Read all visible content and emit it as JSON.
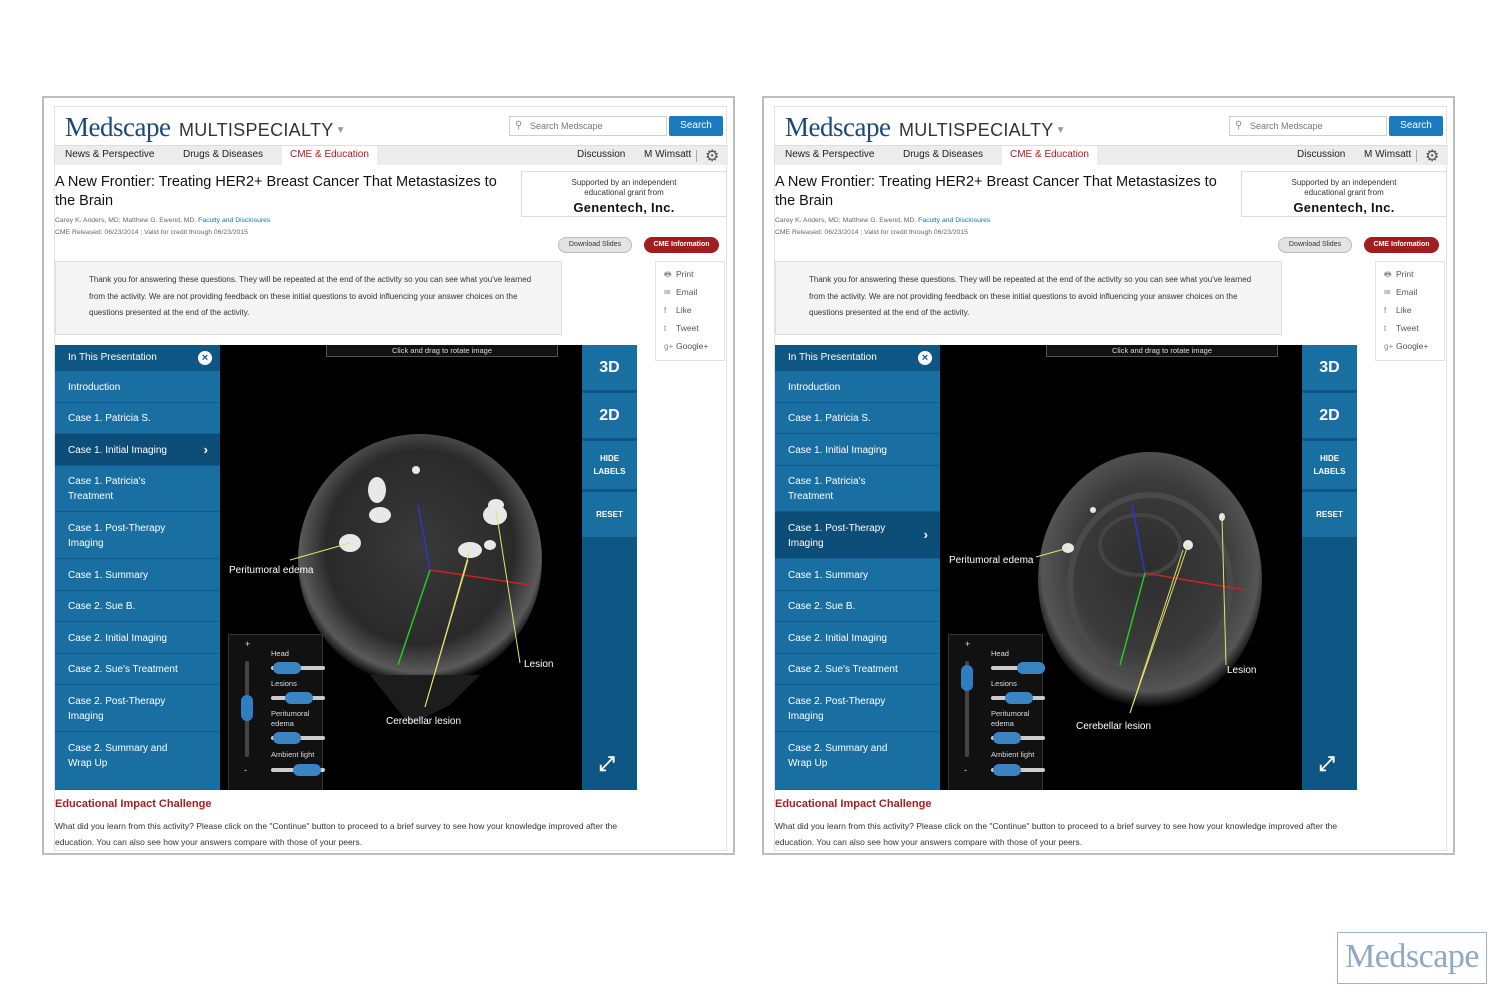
{
  "header": {
    "logo_text": "Medscape",
    "site_section": "MULTISPECIALTY",
    "search_placeholder": "Search Medscape",
    "search_button": "Search"
  },
  "nav": {
    "items": [
      "News & Perspective",
      "Drugs & Diseases",
      "CME & Education"
    ],
    "active_index": 2,
    "discussion": "Discussion",
    "user": "M Wimsatt",
    "settings_icon": "gear-icon"
  },
  "article": {
    "title": "A New Frontier: Treating HER2+ Breast Cancer That Metastasizes to the Brain",
    "authors": "Carey K. Anders, MD; Matthew G. Ewend, MD.",
    "disclosures_link": "Faculty and Disclosures",
    "released": "CME Released: 06/23/2014 ; Valid for credit through 06/23/2015",
    "grant_line": "Supported by an independent educational grant from",
    "grant_company": "Genentech, Inc.",
    "download_slides": "Download Slides",
    "cme_information": "CME Information",
    "thanks_text": "Thank you for answering these questions. They will be repeated at the end of the activity so you can see what you've learned from the activity. We are not providing feedback on these initial questions to avoid influencing your answer choices on the questions presented at the end of the activity."
  },
  "share": {
    "items": [
      {
        "label": "Print",
        "icon": "print-icon"
      },
      {
        "label": "Email",
        "icon": "email-icon"
      },
      {
        "label": "Like",
        "icon": "facebook-icon"
      },
      {
        "label": "Tweet",
        "icon": "twitter-icon"
      },
      {
        "label": "Google+",
        "icon": "googleplus-icon"
      }
    ]
  },
  "presentation": {
    "heading": "In This Presentation",
    "items": [
      "Introduction",
      "Case 1. Patricia S.",
      "Case 1. Initial Imaging",
      "Case 1. Patricia's Treatment",
      "Case 1. Post-Therapy Imaging",
      "Case 1. Summary",
      "Case 2. Sue B.",
      "Case 2. Initial Imaging",
      "Case 2. Sue's Treatment",
      "Case 2. Post-Therapy Imaging",
      "Case 2. Summary and Wrap Up"
    ]
  },
  "viewer": {
    "hint": "Click and drag to rotate image",
    "buttons": {
      "three_d": "3D",
      "two_d": "2D",
      "hide_labels_1": "HIDE",
      "hide_labels_2": "LABELS",
      "reset": "RESET"
    },
    "sliders": {
      "plus": "+",
      "minus": "-",
      "head": "Head",
      "lesions": "Lesions",
      "edema_1": "Peritumoral",
      "edema_2": "edema",
      "ambient": "Ambient light"
    },
    "labels": {
      "edema": "Peritumoral edema",
      "lesion": "Lesion",
      "cerebellar": "Cerebellar lesion"
    }
  },
  "screens": [
    {
      "active_item_index": 2
    },
    {
      "active_item_index": 4
    }
  ],
  "challenge": {
    "title": "Educational Impact Challenge",
    "text": "What did you learn from this activity? Please click on the \"Continue\" button to proceed to a brief survey to see how your knowledge improved after the education. You can also see how your answers compare with those of your peers."
  },
  "watermark": "Medscape",
  "colors": {
    "brand_blue": "#1b4a79",
    "menu_blue": "#1a6fa2",
    "active_menu": "#0d4e78",
    "cme_red": "#a21e1e",
    "search_blue": "#1a7bbf"
  }
}
